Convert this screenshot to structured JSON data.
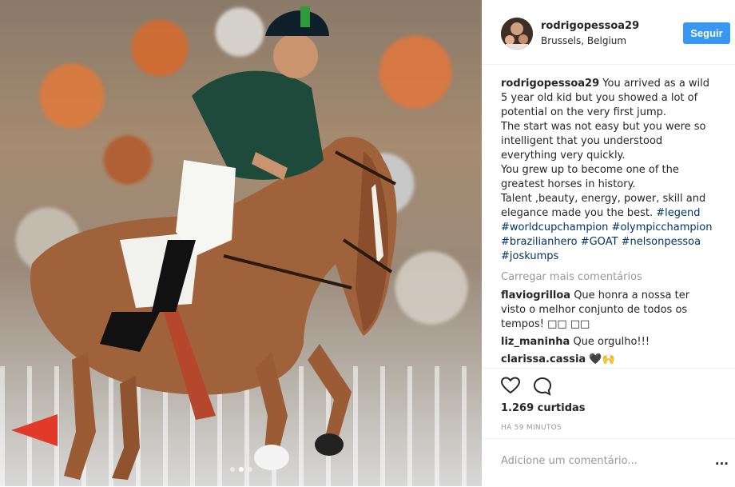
{
  "post": {
    "username": "rodrigopessoa29",
    "location": "Brussels, Belgium",
    "follow_label": "Seguir",
    "caption_user": "rodrigopessoa29",
    "caption_text": "You arrived as a wild 5 year old kid but you showed a lot of potential on the very first jump.\nThe start was not easy but you were so intelligent that you understood everything very quickly.\nYou grew up to become one of the greatest horses in history.\nTalent ,beauty, energy, power, skill and elegance made you the best. ",
    "hashtags": [
      "#legend",
      "#worldcupchampion",
      "#olympicchampion",
      "#brazilianhero",
      "#GOAT",
      "#nelsonpessoa",
      "#joskumps"
    ],
    "load_more": "Carregar mais comentários",
    "comments": [
      {
        "user": "flaviogrilloa",
        "text": "Que honra a nossa ter visto o melhor conjunto de todos os tempos! □□ □□"
      },
      {
        "user": "liz_maninha",
        "text": "Que orgulho!!!"
      },
      {
        "user": "clarissa.cassia",
        "text": "🖤🙌"
      }
    ],
    "likes": "1.269 curtidas",
    "time_ago": "HÁ 59 MINUTOS",
    "add_comment_placeholder": "Adicione um comentário...",
    "more_options": "...",
    "icons": {
      "like": "heart-icon",
      "comment": "comment-bubble-icon"
    }
  },
  "carousel": {
    "slides": 3,
    "active": 1
  }
}
